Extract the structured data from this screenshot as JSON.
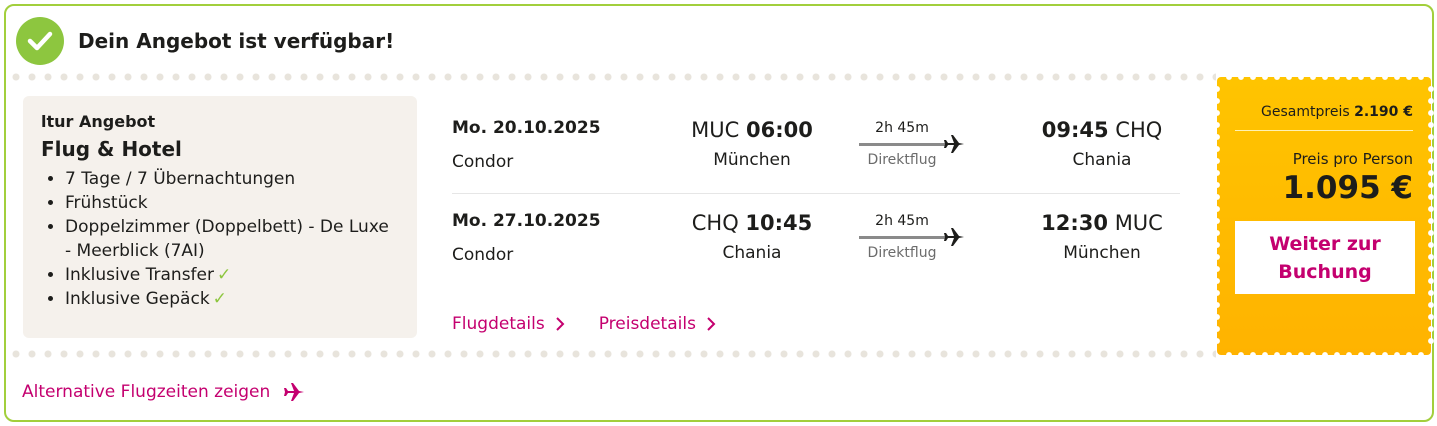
{
  "status": {
    "title": "Dein Angebot ist verfügbar!",
    "icon": "check-circle-icon"
  },
  "offer": {
    "label": "ltur Angebot",
    "title": "Flug & Hotel",
    "features": [
      {
        "text": "7 Tage / 7 Übernachtungen",
        "check": ""
      },
      {
        "text": "Frühstück",
        "check": ""
      },
      {
        "text": "Doppelzimmer (Doppelbett) - De Luxe - Meerblick (7AI)",
        "check": ""
      },
      {
        "text": "Inklusive Transfer",
        "check": "✓"
      },
      {
        "text": "Inklusive Gepäck",
        "check": "✓"
      }
    ]
  },
  "flights": [
    {
      "date": "Mo. 20.10.2025",
      "airline": "Condor",
      "dep_code": "MUC",
      "dep_time": "06:00",
      "dep_city": "München",
      "duration": "2h 45m",
      "kind": "Direktflug",
      "arr_time": "09:45",
      "arr_code": "CHQ",
      "arr_city": "Chania"
    },
    {
      "date": "Mo. 27.10.2025",
      "airline": "Condor",
      "dep_code": "CHQ",
      "dep_time": "10:45",
      "dep_city": "Chania",
      "duration": "2h 45m",
      "kind": "Direktflug",
      "arr_time": "12:30",
      "arr_code": "MUC",
      "arr_city": "München"
    }
  ],
  "links": {
    "flight_details": "Flugdetails",
    "price_details": "Preisdetails",
    "alternative": "Alternative Flugzeiten zeigen"
  },
  "price": {
    "total_label": "Gesamtpreis",
    "total_value": "2.190 €",
    "per_person_label": "Preis pro Person",
    "per_person_value": "1.095 €",
    "book_label": "Weiter zur Buchung"
  },
  "colors": {
    "accent": "#c4006f",
    "green": "#8dc63f",
    "price_bg": "#ffc400",
    "border": "#a2cf3c"
  }
}
